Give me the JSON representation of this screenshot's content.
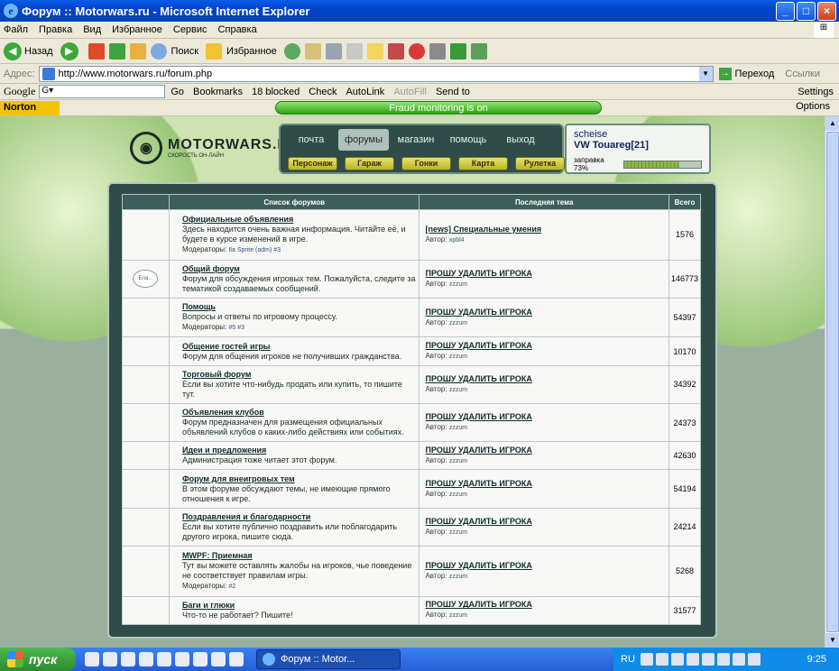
{
  "window": {
    "title": "Форум :: Motorwars.ru - Microsoft Internet Explorer",
    "controls": {
      "minimize": "_",
      "maximize": "□",
      "close": "×"
    }
  },
  "menu": [
    "Файл",
    "Правка",
    "Вид",
    "Избранное",
    "Сервис",
    "Справка"
  ],
  "toolbar": {
    "back": "Назад",
    "search": "Поиск",
    "favorites": "Избранное"
  },
  "address": {
    "label": "Адрес:",
    "url": "http://www.motorwars.ru/forum.php",
    "go": "Переход",
    "links": "Ссылки"
  },
  "googlebar": {
    "brand": "Google",
    "go": "Go",
    "bookmarks": "Bookmarks",
    "blocked": "18 blocked",
    "check": "Check",
    "autolink": "AutoLink",
    "autofill": "AutoFill",
    "sendto": "Send to",
    "settings": "Settings"
  },
  "nortonbar": {
    "brand": "Norton",
    "fraud": "Fraud monitoring is on",
    "options": "Options"
  },
  "site": {
    "brand": "MOTORWARS.RU",
    "slogan": "СКОРОСТЬ ОН-ЛАЙН",
    "nav": [
      "почта",
      "форумы",
      "магазин",
      "помощь",
      "выход"
    ],
    "subnav": [
      "Персонаж",
      "Гараж",
      "Гонки",
      "Карта",
      "Рулетка"
    ],
    "user": {
      "name": "scheise",
      "car": "VW Touareg[21]",
      "fuel_label": "заправка 73%",
      "fuel_level": 0.73
    }
  },
  "forum": {
    "headers": {
      "list": "Список форумов",
      "last": "Последняя тема",
      "total": "Всего"
    },
    "moderators_label": "Модераторы:",
    "author_label": "Автор:",
    "rows": [
      {
        "title": "Официальные объявления",
        "desc": "Здесь находится очень важная информация. Читайте её, и будете в курсе изменений в игре.",
        "mods": "Ila Sprite (adm) #3",
        "last": "[news] Специальные умения",
        "author": "xpbl4",
        "count": "1576",
        "icon": ""
      },
      {
        "title": "Общий форум",
        "desc": "Форум для обсуждения игровых тем. Пожалуйста, следите за тематикой создаваемых сообщений.",
        "mods": "",
        "last": "ПРОШУ УДАЛИТЬ ИГРОКА",
        "author": "zzzum",
        "count": "146773",
        "icon": "Ела..."
      },
      {
        "title": "Помощь",
        "desc": "Вопросы и ответы по игровому процессу.",
        "mods": "#5 #3",
        "last": "ПРОШУ УДАЛИТЬ ИГРОКА",
        "author": "zzzum",
        "count": "54397",
        "icon": ""
      },
      {
        "title": "Общение гостей игры",
        "desc": "Форум для общения игроков не получивших гражданства.",
        "mods": "",
        "last": "ПРОШУ УДАЛИТЬ ИГРОКА",
        "author": "zzzum",
        "count": "10170",
        "icon": ""
      },
      {
        "title": "Торговый форум",
        "desc": "Если вы хотите что-нибудь продать или купить, то пишите тут.",
        "mods": "",
        "last": "ПРОШУ УДАЛИТЬ ИГРОКА",
        "author": "zzzum",
        "count": "34392",
        "icon": ""
      },
      {
        "title": "Объявления клубов",
        "desc": "Форум предназначен для размещения официальных объявлений клубов о каких-либо действиях или событиях.",
        "mods": "",
        "last": "ПРОШУ УДАЛИТЬ ИГРОКА",
        "author": "zzzum",
        "count": "24373",
        "icon": ""
      },
      {
        "title": "Идеи и предложения",
        "desc": "Администрация тоже читает этот форум.",
        "mods": "",
        "last": "ПРОШУ УДАЛИТЬ ИГРОКА",
        "author": "zzzum",
        "count": "42630",
        "icon": ""
      },
      {
        "title": "Форум для внеигровых тем",
        "desc": "В этом форуме обсуждают темы, не имеющие прямого отношения к игре.",
        "mods": "",
        "last": "ПРОШУ УДАЛИТЬ ИГРОКА",
        "author": "zzzum",
        "count": "54194",
        "icon": ""
      },
      {
        "title": "Поздравления и благодарности",
        "desc": "Если вы хотите публично поздравить или поблагодарить другого игрока, пишите сюда.",
        "mods": "",
        "last": "ПРОШУ УДАЛИТЬ ИГРОКА",
        "author": "zzzum",
        "count": "24214",
        "icon": ""
      },
      {
        "title": "MWPF: Приемная",
        "desc": "Тут вы можете оставлять жалобы на игроков, чье поведение не соответствует правилам игры.",
        "mods": "#2",
        "last": "ПРОШУ УДАЛИТЬ ИГРОКА",
        "author": "zzzum",
        "count": "5268",
        "icon": ""
      },
      {
        "title": "Баги и глюки",
        "desc": "Что-то не работает? Пишите!",
        "mods": "",
        "last": "ПРОШУ УДАЛИТЬ ИГРОКА",
        "author": "zzzum",
        "count": "31577",
        "icon": ""
      }
    ]
  },
  "taskbar": {
    "start": "пуск",
    "task": "Форум :: Motor...",
    "lang": "RU",
    "clock": "9:25"
  }
}
